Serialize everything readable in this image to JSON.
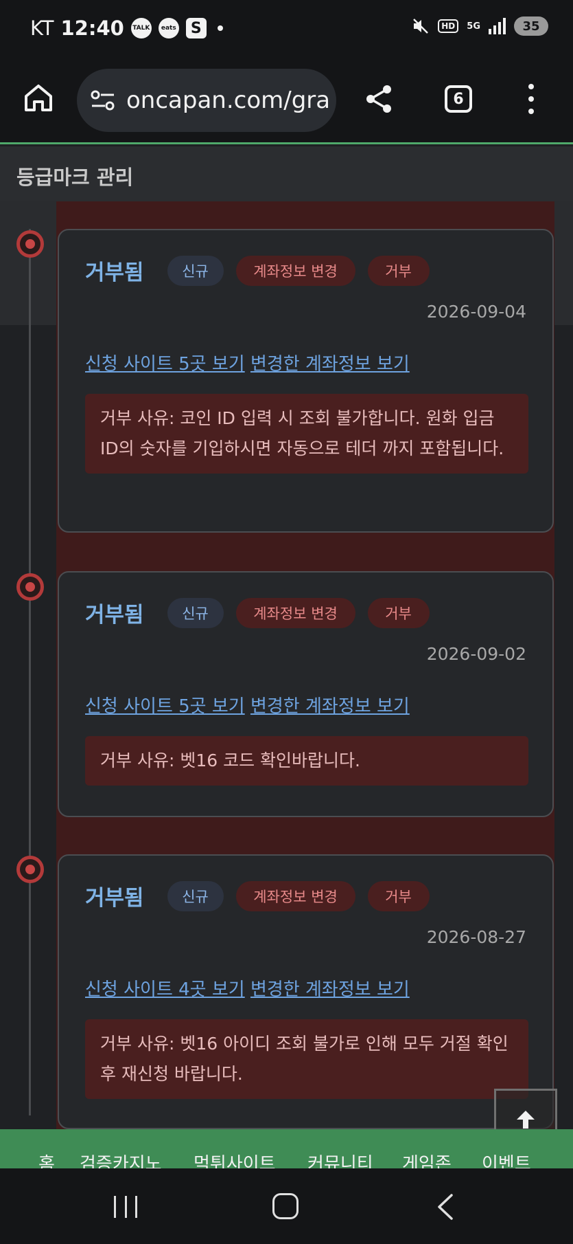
{
  "status_bar": {
    "carrier": "KT",
    "time": "12:40",
    "talk_icon_label": "TALK",
    "eats_icon_label": "eats",
    "s_icon_label": "S",
    "hd_label": "HD",
    "network_label": "5G",
    "battery": "35"
  },
  "browser": {
    "url": "oncapan.com/gra",
    "tab_count": "6"
  },
  "page": {
    "title": "등급마크 관리"
  },
  "entries": [
    {
      "status": "거부됨",
      "badges": [
        "신규",
        "계좌정보 변경",
        "거부"
      ],
      "date": "2026-09-04",
      "link_sites": "신청 사이트 5곳 보기",
      "link_account": "변경한 계좌정보 보기",
      "reason": "거부 사유: 코인 ID 입력 시 조회 불가합니다. 원화 입금 ID의 숫자를 기입하시면 자동으로 테더 까지 포함됩니다."
    },
    {
      "status": "거부됨",
      "badges": [
        "신규",
        "계좌정보 변경",
        "거부"
      ],
      "date": "2026-09-02",
      "link_sites": "신청 사이트 5곳 보기",
      "link_account": "변경한 계좌정보 보기",
      "reason": "거부 사유: 벳16 코드 확인바랍니다."
    },
    {
      "status": "거부됨",
      "badges": [
        "신규",
        "계좌정보 변경",
        "거부"
      ],
      "date": "2026-08-27",
      "link_sites": "신청 사이트 4곳 보기",
      "link_account": "변경한 계좌정보 보기",
      "reason": "거부 사유: 벳16 아이디 조회 불가로 인해 모두 거절 확인 후 재신청 바랍니다."
    }
  ],
  "bottom_nav": {
    "items": [
      "홈",
      "검증카지노",
      "먹튀사이트",
      "커뮤니티",
      "게임존",
      "이벤트"
    ]
  },
  "colors": {
    "accent_green": "#3f8c55",
    "link_blue": "#6ea3e0",
    "reject_red": "#c84646"
  }
}
